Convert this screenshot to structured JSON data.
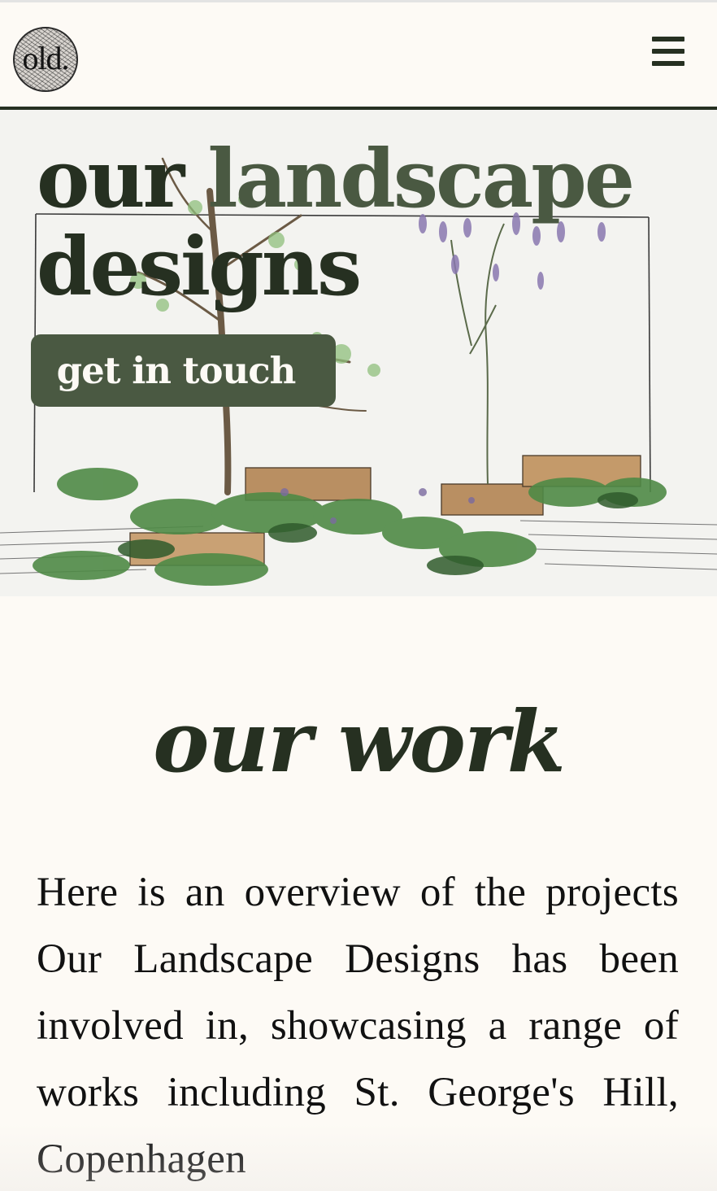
{
  "header": {
    "logo_text": "old.",
    "menu_icon": "hamburger-menu-icon"
  },
  "hero": {
    "title_word1": "our",
    "title_word2": "landscape",
    "title_word3": "designs",
    "cta_label": "get in touch",
    "image_icon": "garden-sketch-illustration"
  },
  "work": {
    "title": "our work",
    "intro": "Here is an overview of the projects Our Landscape Designs has been involved in, showcasing a range of works including St. George's Hill, Copenhagen"
  },
  "colors": {
    "background": "#fdfaf5",
    "dark_green": "#263021",
    "moss_green": "#4a5942"
  }
}
